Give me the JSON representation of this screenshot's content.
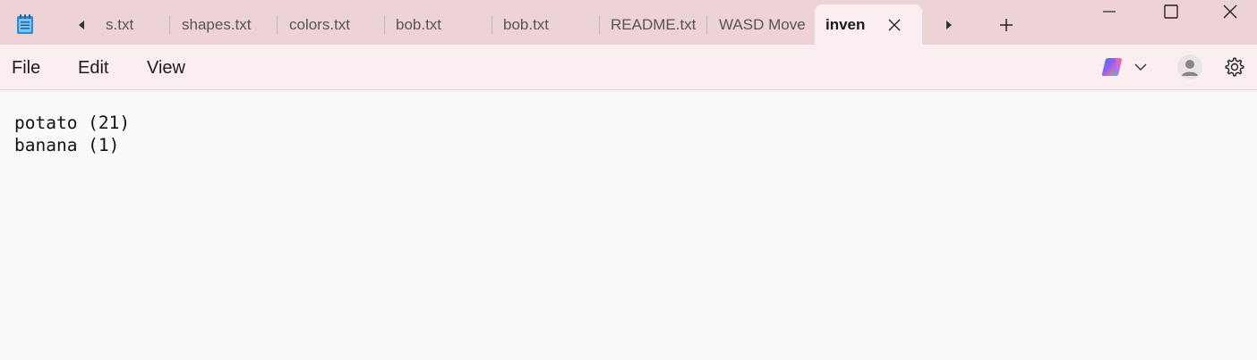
{
  "app": {
    "icon": "notepad-icon",
    "accent": "#1e6fbf"
  },
  "tabs": [
    {
      "label": "s.txt",
      "active": false
    },
    {
      "label": "shapes.txt",
      "active": false
    },
    {
      "label": "colors.txt",
      "active": false
    },
    {
      "label": "bob.txt",
      "active": false
    },
    {
      "label": "bob.txt",
      "active": false
    },
    {
      "label": "README.txt",
      "active": false
    },
    {
      "label": "WASD Move",
      "active": false
    },
    {
      "label": "inven",
      "active": true
    }
  ],
  "tab_controls": {
    "scroll_left_icon": "triangle-left-icon",
    "scroll_right_icon": "triangle-right-icon",
    "close_icon": "close-icon",
    "new_tab_icon": "plus-icon"
  },
  "window_controls": {
    "minimize_icon": "minimize-icon",
    "maximize_icon": "maximize-icon",
    "close_icon": "close-icon"
  },
  "menu": {
    "file": "File",
    "edit": "Edit",
    "view": "View"
  },
  "toolbar_right": {
    "copilot_icon": "copilot-icon",
    "chevron_icon": "chevron-down-icon",
    "account_icon": "account-icon",
    "settings_icon": "gear-icon"
  },
  "document": {
    "lines": [
      "potato (21)",
      "banana (1)"
    ]
  },
  "colors": {
    "titlebar": "#eed3d6",
    "menubar": "#fbeef0",
    "editor": "#f9f9f9"
  }
}
